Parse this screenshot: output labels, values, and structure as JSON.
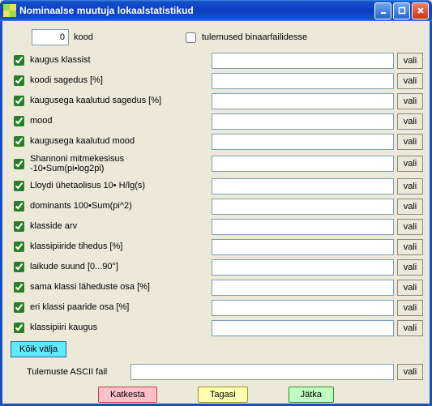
{
  "window": {
    "title": "Nominaalse muutuja lokaalstatistikud"
  },
  "top": {
    "kood_value": "0",
    "kood_label": "kood",
    "binary_label": "tulemused binaarfailidesse",
    "binary_checked": false
  },
  "rows": [
    {
      "label": "kaugus klassist",
      "checked": true,
      "value": ""
    },
    {
      "label": "koodi sagedus [%]",
      "checked": true,
      "value": ""
    },
    {
      "label": "kaugusega kaalutud sagedus [%]",
      "checked": true,
      "value": ""
    },
    {
      "label": "mood",
      "checked": true,
      "value": ""
    },
    {
      "label": "kaugusega kaalutud mood",
      "checked": true,
      "value": ""
    },
    {
      "label": "Shannoni mitmekesisus\n-10•Sum(pi•log2pi)",
      "checked": true,
      "value": ""
    },
    {
      "label": "Lloydi ühetaolisus  10• H/lg(s)",
      "checked": true,
      "value": ""
    },
    {
      "label": "dominants 100•Sum(pi^2)",
      "checked": true,
      "value": ""
    },
    {
      "label": "klasside arv",
      "checked": true,
      "value": ""
    },
    {
      "label": "klassipiiride tihedus [%]",
      "checked": true,
      "value": ""
    },
    {
      "label": "laikude suund [0...90°]",
      "checked": true,
      "value": ""
    },
    {
      "label": "sama klassi läheduste osa [%]",
      "checked": true,
      "value": ""
    },
    {
      "label": "eri klassi paaride osa [%]",
      "checked": true,
      "value": ""
    },
    {
      "label": "klassipiiri kaugus",
      "checked": true,
      "value": ""
    }
  ],
  "vali_label": "vali",
  "koik_label": "Kõik välja",
  "ascii": {
    "label": "Tulemuste ASCII fail",
    "value": ""
  },
  "buttons": {
    "cancel": "Katkesta",
    "back": "Tagasi",
    "next": "Jätka"
  }
}
